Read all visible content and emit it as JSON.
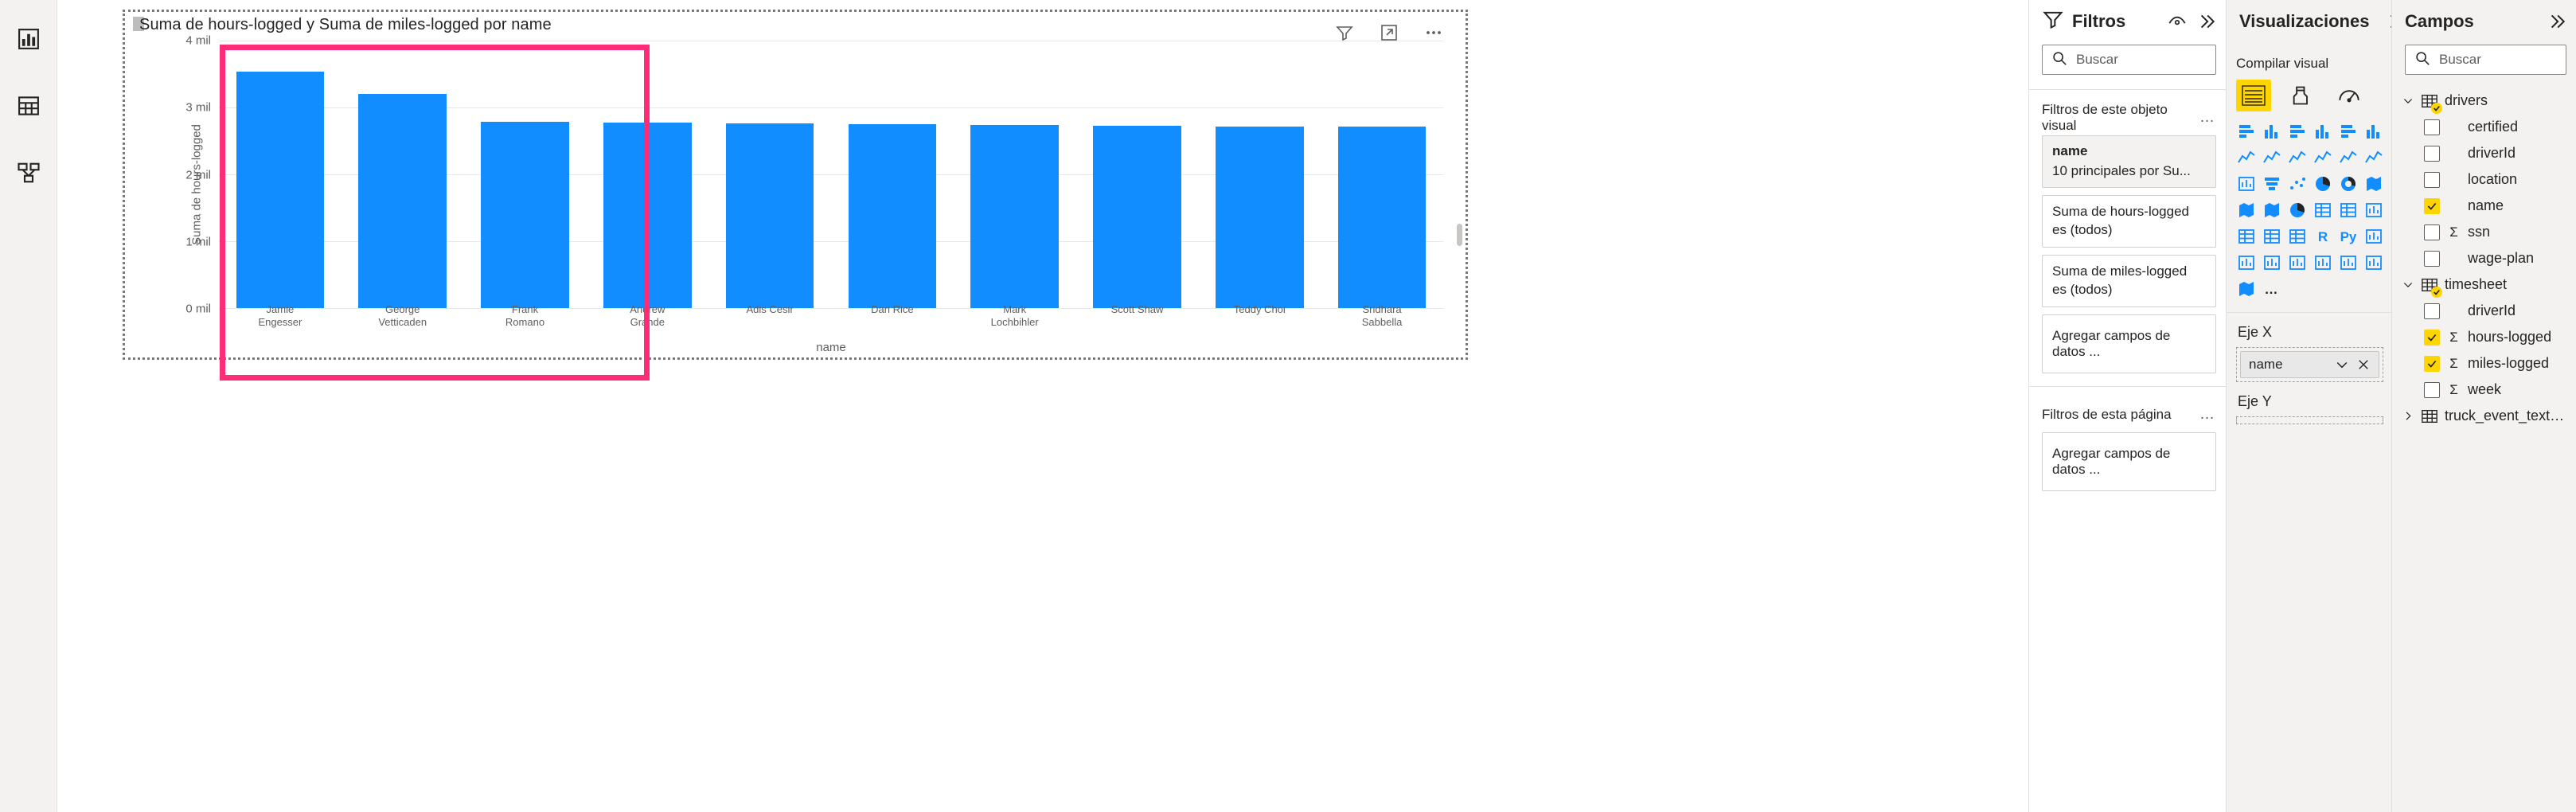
{
  "rail": {
    "items": [
      {
        "name": "report-view-icon",
        "label": "Vista de informe"
      },
      {
        "name": "data-view-icon",
        "label": "Vista de datos"
      },
      {
        "name": "model-view-icon",
        "label": "Vista de modelo"
      }
    ]
  },
  "visual": {
    "title": "Suma de hours-logged y Suma de miles-logged por name",
    "header_icons": [
      {
        "name": "filter-icon",
        "label": "Filtros"
      },
      {
        "name": "focus-mode-icon",
        "label": "Modo de enfoque"
      },
      {
        "name": "more-options-icon",
        "label": "Más opciones"
      }
    ]
  },
  "chart_data": {
    "type": "bar",
    "title": "Suma de hours-logged y Suma de miles-logged por name",
    "xlabel": "name",
    "ylabel": "Suma de hours-logged",
    "ylim": [
      0,
      4000
    ],
    "ytick_labels": [
      "0 mil",
      "1 mil",
      "2 mil",
      "3 mil",
      "4 mil"
    ],
    "ytick_values": [
      0,
      1000,
      2000,
      3000,
      4000
    ],
    "grid": true,
    "legend": "none",
    "bar_color": "#118DFF",
    "categories": [
      "Jamie\nEngesser",
      "George\nVetticaden",
      "Frank\nRomano",
      "Andrew\nGrande",
      "Adis Cesir",
      "Dan Rice",
      "Mark\nLochbihler",
      "Scott Shaw",
      "Teddy Choi",
      "Sridhara\nSabbella"
    ],
    "series": [
      {
        "name": "Suma de hours-logged",
        "values": [
          3530,
          3200,
          2790,
          2770,
          2760,
          2750,
          2740,
          2730,
          2720,
          2710
        ]
      }
    ]
  },
  "selection": {
    "color": "#FF2D78"
  },
  "filters": {
    "title": "Filtros",
    "header_icons": [
      {
        "name": "eye-icon",
        "label": "Ocultar"
      },
      {
        "name": "expand-chevrons-icon",
        "label": "Expandir panel de filtros"
      }
    ],
    "search_placeholder": "Buscar",
    "visual_section": {
      "label": "Filtros de este objeto visual",
      "menu": "…",
      "cards": [
        {
          "name": "name",
          "value": "10 principales por Su...",
          "active": true
        },
        {
          "name": "Suma de hours-logged",
          "value": "es (todos)",
          "active": false
        },
        {
          "name": "Suma de miles-logged",
          "value": "es (todos)",
          "active": false
        }
      ],
      "drop_label": "Agregar campos de datos ..."
    },
    "page_section": {
      "label": "Filtros de esta página",
      "menu": "…",
      "drop_label": "Agregar campos de datos ..."
    }
  },
  "visualizations": {
    "title": "Visualizaciones",
    "header_icons": [
      {
        "name": "expand-chevrons-icon",
        "label": "Expandir panel"
      }
    ],
    "subtitle": "Compilar visual",
    "tabs": [
      {
        "name": "build-visual-tab",
        "label": "Compilar visual",
        "selected": true
      },
      {
        "name": "format-visual-tab",
        "label": "Formato del objeto visual",
        "selected": false
      },
      {
        "name": "analytics-tab",
        "label": "Análisis",
        "selected": false
      }
    ],
    "gallery": [
      "stacked-bar-chart-icon",
      "stacked-column-chart-icon",
      "clustered-bar-chart-icon",
      "clustered-column-chart-icon",
      "100-stacked-bar-chart-icon",
      "100-stacked-column-chart-icon",
      "line-chart-icon",
      "area-chart-icon",
      "stacked-area-chart-icon",
      "line-stacked-column-chart-icon",
      "line-clustered-column-chart-icon",
      "ribbon-chart-icon",
      "waterfall-chart-icon",
      "funnel-chart-icon",
      "scatter-chart-icon",
      "pie-chart-icon",
      "donut-chart-icon",
      "treemap-icon",
      "map-icon",
      "filled-map-icon",
      "gauge-icon",
      "card-icon",
      "multi-row-card-icon",
      "kpi-icon",
      "slicer-icon",
      "table-icon",
      "matrix-icon",
      "r-script-visual-icon",
      "python-visual-icon",
      "key-influencers-icon",
      "decomposition-tree-icon",
      "q-and-a-icon",
      "narrative-icon",
      "paginated-report-icon",
      "power-apps-icon",
      "smart-narrative-icon",
      "arcgis-maps-icon",
      "more-visuals-icon"
    ],
    "gallery_labels": {
      "r-script-visual-icon": "R",
      "python-visual-icon": "Py"
    },
    "wells": [
      {
        "name": "Eje X",
        "chip": "name",
        "has_chip": true
      },
      {
        "name": "Eje Y",
        "chip": "",
        "has_chip": false
      }
    ]
  },
  "fields": {
    "title": "Campos",
    "header_icons": [
      {
        "name": "expand-chevrons-icon",
        "label": "Expandir panel"
      }
    ],
    "search_placeholder": "Buscar",
    "tree": [
      {
        "table": "drivers",
        "expanded": true,
        "checked": true,
        "fields": [
          {
            "label": "certified",
            "checked": false,
            "aggregate": false
          },
          {
            "label": "driverId",
            "checked": false,
            "aggregate": false
          },
          {
            "label": "location",
            "checked": false,
            "aggregate": false
          },
          {
            "label": "name",
            "checked": true,
            "aggregate": false
          },
          {
            "label": "ssn",
            "checked": false,
            "aggregate": true
          },
          {
            "label": "wage-plan",
            "checked": false,
            "aggregate": false
          }
        ]
      },
      {
        "table": "timesheet",
        "expanded": true,
        "checked": true,
        "fields": [
          {
            "label": "driverId",
            "checked": false,
            "aggregate": false
          },
          {
            "label": "hours-logged",
            "checked": true,
            "aggregate": true
          },
          {
            "label": "miles-logged",
            "checked": true,
            "aggregate": true
          },
          {
            "label": "week",
            "checked": false,
            "aggregate": true
          }
        ]
      },
      {
        "table": "truck_event_text_partiti...",
        "expanded": false,
        "checked": false,
        "fields": []
      }
    ]
  }
}
